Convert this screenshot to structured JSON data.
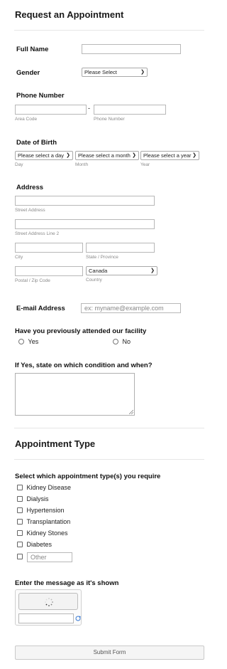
{
  "title": "Request an Appointment",
  "full_name": {
    "label": "Full Name",
    "value": ""
  },
  "gender": {
    "label": "Gender",
    "selected": "Please Select"
  },
  "phone": {
    "label": "Phone Number",
    "area_sub": "Area Code",
    "num_sub": "Phone Number",
    "dash": "-"
  },
  "dob": {
    "label": "Date of Birth",
    "day": "Please select a day",
    "month": "Please select a month",
    "year": "Please select a year",
    "day_sub": "Day",
    "month_sub": "Month",
    "year_sub": "Year"
  },
  "address": {
    "label": "Address",
    "street_sub": "Street Address",
    "street2_sub": "Street Address Line 2",
    "city_sub": "City",
    "state_sub": "State / Province",
    "postal_sub": "Postal / Zip Code",
    "country_sub": "Country",
    "country_selected": "Canada"
  },
  "email": {
    "label": "E-mail Address",
    "placeholder": "ex: myname@example.com"
  },
  "attended": {
    "label": "Have you previously attended our facility",
    "yes": "Yes",
    "no": "No"
  },
  "condition": {
    "label": "If Yes, state on which condition and when?"
  },
  "appt_type": {
    "title": "Appointment Type"
  },
  "types": {
    "label": "Select which appointment type(s) you require",
    "options": [
      "Kidney Disease",
      "Dialysis",
      "Hypertension",
      "Transplantation",
      "Kidney Stones",
      "Diabetes"
    ],
    "other_placeholder": "Other"
  },
  "captcha": {
    "label": "Enter the message as it's shown"
  },
  "submit": {
    "label": "Submit Form"
  }
}
